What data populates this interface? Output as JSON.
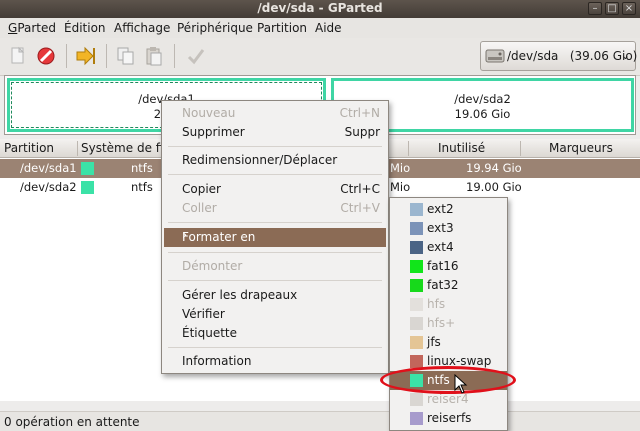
{
  "window": {
    "title": "/dev/sda - GParted",
    "controls": {
      "minimize": "–",
      "maximize": "□",
      "close": "×"
    }
  },
  "menubar": [
    {
      "label": "GParted",
      "u": "G"
    },
    {
      "label": "Édition",
      "u": "É"
    },
    {
      "label": "Affichage",
      "u": "A"
    },
    {
      "label": "Périphérique",
      "u": "P"
    },
    {
      "label": "Partition",
      "u": "P"
    },
    {
      "label": "Aide",
      "u": "A"
    }
  ],
  "toolbar": {
    "icons": [
      "new-icon",
      "delete-icon",
      "resize-icon",
      "copy-icon",
      "paste-icon",
      "apply-icon"
    ],
    "device": "/dev/sda   (39.06 Gio)"
  },
  "graphic": {
    "partitions": [
      {
        "name": "/dev/sda1",
        "size": "20.0"
      },
      {
        "name": "/dev/sda2",
        "size": "19.06 Gio"
      }
    ]
  },
  "table": {
    "columns": [
      "Partition",
      "Système de fic",
      "Inutilisé",
      "Marqueurs"
    ],
    "rows": [
      {
        "partition": "/dev/sda1",
        "fs": "ntfs",
        "used_tail": "Mio",
        "unused": "19.94 Gio",
        "color": "#3be2a7"
      },
      {
        "partition": "/dev/sda2",
        "fs": "ntfs",
        "used_tail": "Mio",
        "unused": "19.00 Gio",
        "color": "#3be2a7"
      }
    ]
  },
  "context_menu": {
    "items": [
      {
        "label": "Nouveau",
        "shortcut": "Ctrl+N",
        "enabled": false
      },
      {
        "label": "Supprimer",
        "shortcut": "Suppr",
        "enabled": true
      },
      {
        "label": "Redimensionner/Déplacer",
        "shortcut": "",
        "enabled": true
      },
      {
        "label": "Copier",
        "shortcut": "Ctrl+C",
        "enabled": true
      },
      {
        "label": "Coller",
        "shortcut": "Ctrl+V",
        "enabled": false
      },
      {
        "label": "Formater en",
        "shortcut": "",
        "enabled": true
      },
      {
        "label": "Démonter",
        "shortcut": "",
        "enabled": false
      },
      {
        "label": "Gérer les drapeaux",
        "shortcut": "",
        "enabled": true
      },
      {
        "label": "Vérifier",
        "shortcut": "",
        "enabled": true
      },
      {
        "label": "Étiquette",
        "shortcut": "",
        "enabled": true
      },
      {
        "label": "Information",
        "shortcut": "",
        "enabled": true
      }
    ],
    "submenu_arrow": "›"
  },
  "format_submenu": [
    {
      "label": "ext2",
      "color": "#9bb6cf",
      "enabled": true
    },
    {
      "label": "ext3",
      "color": "#7c93b8",
      "enabled": true
    },
    {
      "label": "ext4",
      "color": "#4b6485",
      "enabled": true
    },
    {
      "label": "fat16",
      "color": "#11e51a",
      "enabled": true
    },
    {
      "label": "fat32",
      "color": "#17d91b",
      "enabled": true
    },
    {
      "label": "hfs",
      "color": "#e3e0dc",
      "enabled": false
    },
    {
      "label": "hfs+",
      "color": "#d9d6d2",
      "enabled": false
    },
    {
      "label": "jfs",
      "color": "#e4c595",
      "enabled": true
    },
    {
      "label": "linux-swap",
      "color": "#c2665b",
      "enabled": true
    },
    {
      "label": "ntfs",
      "color": "#3be2a7",
      "enabled": true,
      "highlighted": true
    },
    {
      "label": "reiser4",
      "color": "#d9d6d2",
      "enabled": false
    },
    {
      "label": "reiserfs",
      "color": "#a79bcc",
      "enabled": true
    }
  ],
  "status": "0 opération en attente"
}
